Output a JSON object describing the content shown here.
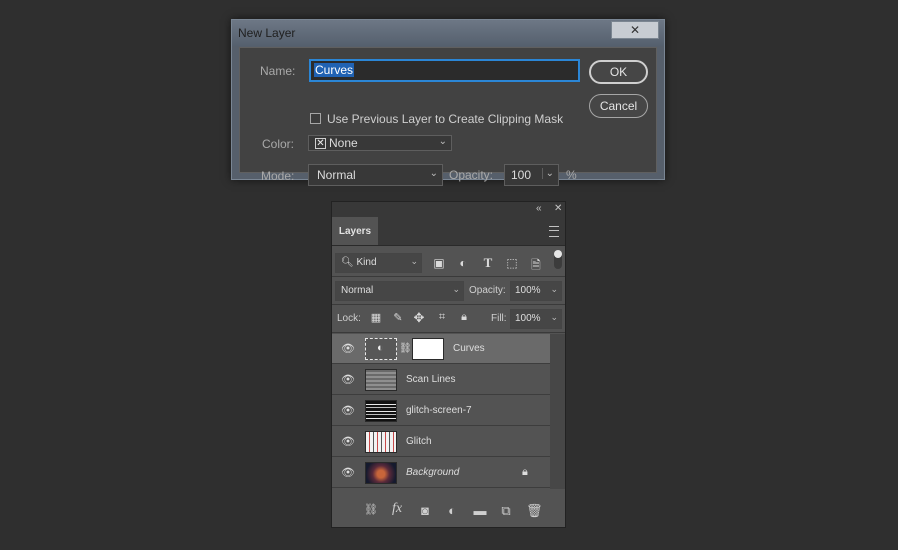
{
  "dialog": {
    "title": "New Layer",
    "close_label": "✕",
    "name_label": "Name:",
    "name_value": "Curves",
    "clipping_label": "Use Previous Layer to Create Clipping Mask",
    "clipping_checked": false,
    "color_label": "Color:",
    "color_value": "None",
    "mode_label": "Mode:",
    "mode_value": "Normal",
    "opacity_label": "Opacity:",
    "opacity_value": "100",
    "opacity_unit": "%",
    "ok_label": "OK",
    "cancel_label": "Cancel"
  },
  "panel": {
    "tab_label": "Layers",
    "filter_value": "Kind",
    "blend_mode": "Normal",
    "opacity_label": "Opacity:",
    "opacity_value": "100%",
    "lock_label": "Lock:",
    "fill_label": "Fill:",
    "fill_value": "100%",
    "layers": [
      {
        "name": "Curves",
        "selected": true,
        "italic": false,
        "locked": false
      },
      {
        "name": "Scan Lines",
        "selected": false,
        "italic": false,
        "locked": false
      },
      {
        "name": "glitch-screen-7",
        "selected": false,
        "italic": false,
        "locked": false
      },
      {
        "name": "Glitch",
        "selected": false,
        "italic": false,
        "locked": false
      },
      {
        "name": "Background",
        "selected": false,
        "italic": true,
        "locked": true
      }
    ],
    "footer_icons": [
      "link-icon",
      "fx-icon",
      "mask-icon",
      "adjustment-icon",
      "folder-icon",
      "new-layer-icon",
      "trash-icon"
    ]
  },
  "colors": {
    "accent": "#2b86d6",
    "background": "#2f2f2f",
    "panel": "#535353"
  }
}
